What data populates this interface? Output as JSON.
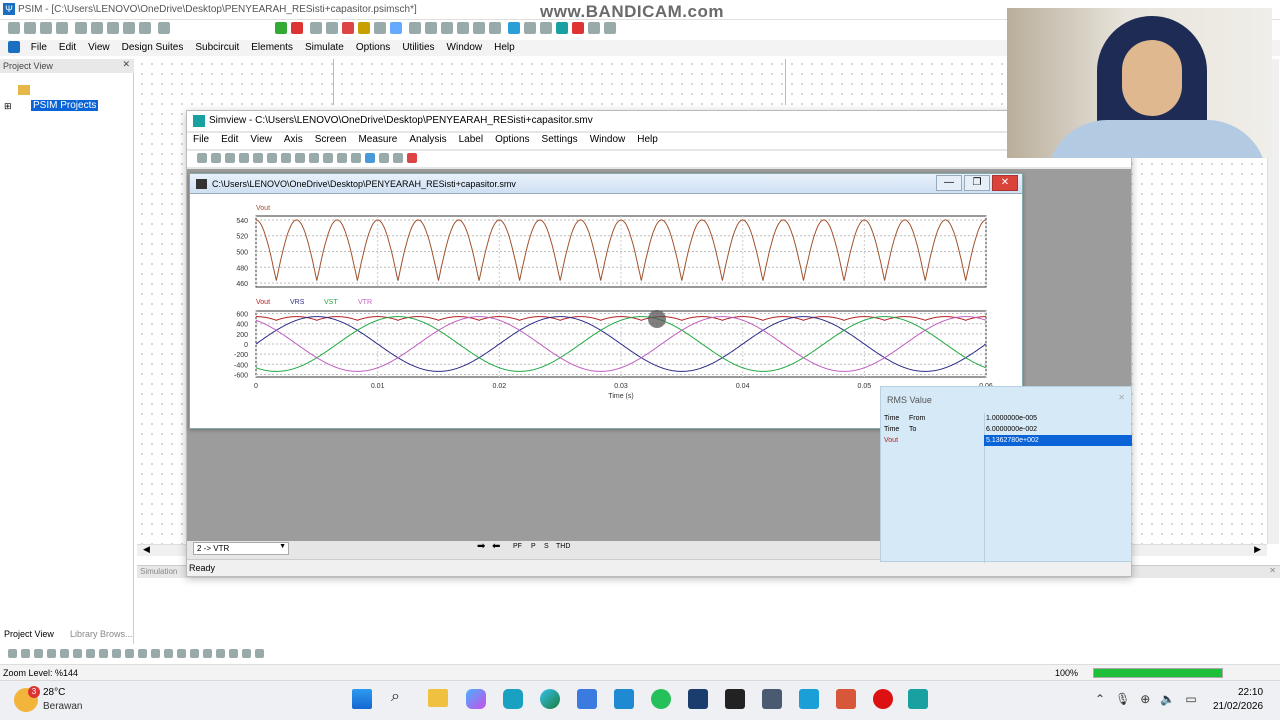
{
  "psim": {
    "title": "PSIM - [C:\\Users\\LENOVO\\OneDrive\\Desktop\\PENYEARAH_RESisti+capasitor.psimsch*]",
    "watermark": "www.BANDICAM.com",
    "menu": [
      "File",
      "Edit",
      "View",
      "Design Suites",
      "Subcircuit",
      "Elements",
      "Simulate",
      "Options",
      "Utilities",
      "Window",
      "Help"
    ],
    "project_view": {
      "title": "Project View",
      "item": "PSIM Projects"
    },
    "tabs": [
      "Project View",
      "Library Brows..."
    ],
    "simulation_tab": "Simulation",
    "zoom": "Zoom Level: %144",
    "progress_label": "100%",
    "progress": 1.0
  },
  "simview": {
    "title": "Simview - C:\\Users\\LENOVO\\OneDrive\\Desktop\\PENYEARAH_RESisti+capasitor.smv",
    "menu": [
      "File",
      "Edit",
      "View",
      "Axis",
      "Screen",
      "Measure",
      "Analysis",
      "Label",
      "Options",
      "Settings",
      "Window",
      "Help"
    ],
    "inner_title": "C:\\Users\\LENOVO\\OneDrive\\Desktop\\PENYEARAH_RESisti+capasitor.smv",
    "inner_buttons": [
      "—",
      "❐",
      "✕"
    ],
    "combo": "2 -> VTR",
    "toolbar_text": [
      "PF",
      "P",
      "S",
      "THD"
    ],
    "status": "Ready"
  },
  "chart_data": [
    {
      "type": "line",
      "series": [
        {
          "name": "Vout",
          "color": "#a0522d"
        }
      ],
      "y_ticks": [
        "540",
        "520",
        "500",
        "480",
        "460"
      ],
      "ylim": [
        455,
        545
      ],
      "ripple_min": 463,
      "ripple_max": 540,
      "ripple_peaks": 18,
      "x_range": [
        0,
        0.06
      ]
    },
    {
      "type": "line",
      "series": [
        {
          "name": "Vout",
          "color": "#b22222"
        },
        {
          "name": "VRS",
          "color": "#2e2e8a"
        },
        {
          "name": "VST",
          "color": "#22aa44"
        },
        {
          "name": "VTR",
          "color": "#c060c0"
        }
      ],
      "y_ticks": [
        "600",
        "400",
        "200",
        "0",
        "-200",
        "-400",
        "-600"
      ],
      "ylim": [
        -650,
        650
      ],
      "amplitude": 540,
      "frequency_hz": 50,
      "x_ticks": [
        "0",
        "0.01",
        "0.02",
        "0.03",
        "0.04",
        "0.05",
        "0.06"
      ],
      "xlim": [
        0,
        0.06
      ],
      "xlabel": "Time (s)"
    }
  ],
  "rms": {
    "title": "RMS Value",
    "rows": [
      {
        "label": "Time",
        "sub": "From",
        "value": "1.0000000e-005"
      },
      {
        "label": "Time",
        "sub": "To",
        "value": "6.0000000e-002"
      },
      {
        "label": "Vout",
        "sub": "",
        "value": "5.1362780e+002"
      }
    ]
  },
  "taskbar": {
    "weather_temp": "28°C",
    "weather_desc": "Berawan",
    "badge": "3",
    "time": "22:10",
    "date": "21/02/2026"
  }
}
